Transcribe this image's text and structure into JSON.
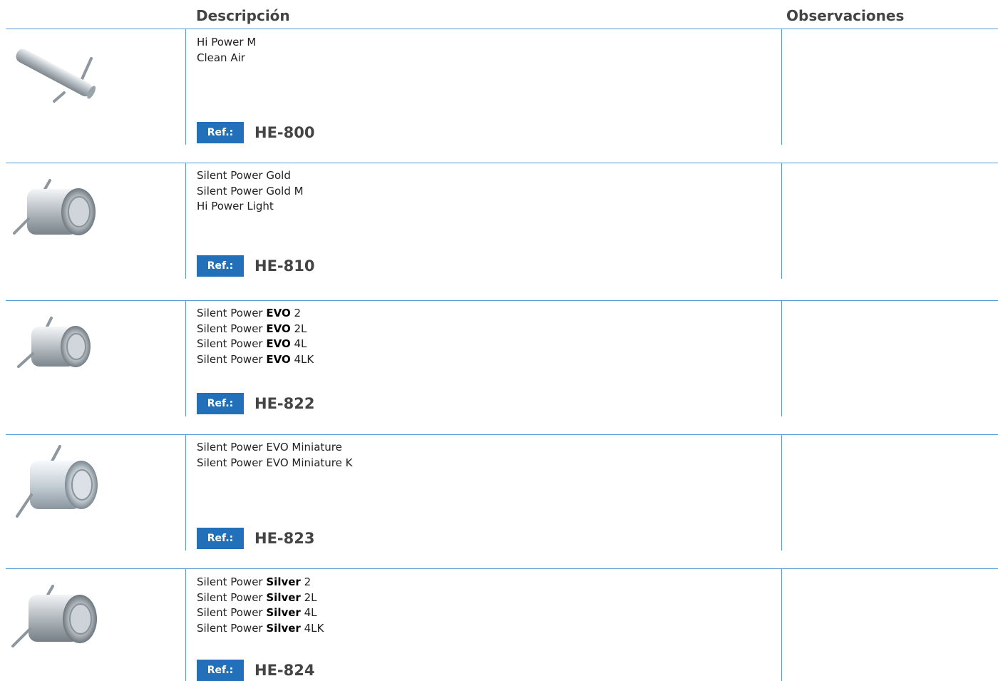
{
  "header": {
    "description": "Descripción",
    "observations": "Observaciones"
  },
  "ref_label": "Ref.:",
  "rows": [
    {
      "ref": "HE-800",
      "image": "long-handle-tool",
      "lines": [
        {
          "pre": "Hi Power M",
          "bold": "",
          "post": ""
        },
        {
          "pre": "Clean Air",
          "bold": "",
          "post": ""
        }
      ],
      "observations": ""
    },
    {
      "ref": "HE-810",
      "image": "cylinder-pin-tool",
      "lines": [
        {
          "pre": "Silent Power Gold",
          "bold": "",
          "post": ""
        },
        {
          "pre": "Silent Power Gold M",
          "bold": "",
          "post": ""
        },
        {
          "pre": "Hi Power Light",
          "bold": "",
          "post": ""
        }
      ],
      "observations": ""
    },
    {
      "ref": "HE-822",
      "image": "cylinder-pin-tool",
      "lines": [
        {
          "pre": "Silent Power ",
          "bold": "EVO",
          "post": " 2"
        },
        {
          "pre": "Silent Power ",
          "bold": "EVO",
          "post": " 2L"
        },
        {
          "pre": "Silent Power ",
          "bold": "EVO",
          "post": " 4L"
        },
        {
          "pre": "Silent Power ",
          "bold": "EVO",
          "post": " 4LK"
        }
      ],
      "observations": ""
    },
    {
      "ref": "HE-823",
      "image": "cylinder-pin-tool",
      "lines": [
        {
          "pre": "Silent Power EVO Miniature",
          "bold": "",
          "post": ""
        },
        {
          "pre": "Silent Power EVO Miniature K",
          "bold": "",
          "post": ""
        }
      ],
      "observations": ""
    },
    {
      "ref": "HE-824",
      "image": "cylinder-pin-tool",
      "lines": [
        {
          "pre": "Silent Power ",
          "bold": "Silver",
          "post": " 2"
        },
        {
          "pre": "Silent Power ",
          "bold": "Silver",
          "post": " 2L"
        },
        {
          "pre": "Silent Power ",
          "bold": "Silver",
          "post": " 4L"
        },
        {
          "pre": "Silent Power ",
          "bold": "Silver",
          "post": " 4LK"
        }
      ],
      "observations": ""
    }
  ],
  "colors": {
    "rule": "#5b9bd5",
    "badge": "#2170b9",
    "heading": "#444444"
  }
}
